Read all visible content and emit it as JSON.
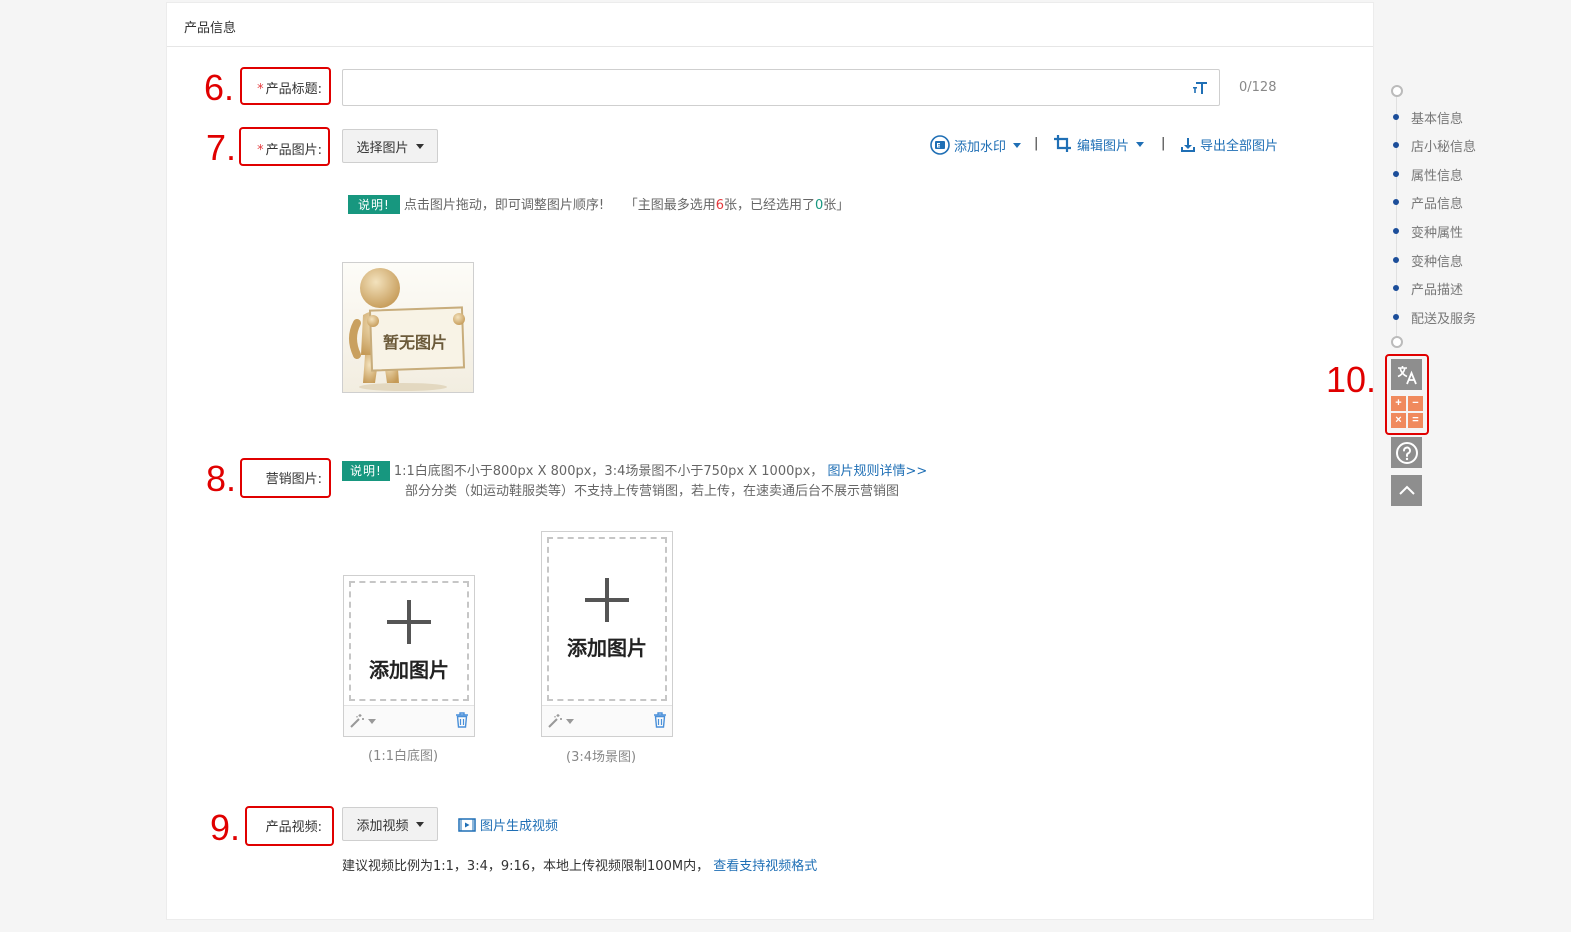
{
  "section": {
    "title": "产品信息"
  },
  "annotations": [
    "6.",
    "7.",
    "8.",
    "9.",
    "10."
  ],
  "product_title": {
    "required_mark": "*",
    "label": "产品标题:",
    "value": "",
    "counter": "0/128"
  },
  "product_images": {
    "required_mark": "*",
    "label": "产品图片:",
    "select_button": "选择图片",
    "tools": {
      "watermark": "添加水印",
      "edit": "编辑图片",
      "export": "导出全部图片",
      "separator": "|"
    },
    "note": {
      "badge": "说明!",
      "text": "点击图片拖动，即可调整图片顺序!",
      "limit_prefix": "「主图最多选用",
      "limit_max": "6",
      "limit_middle": "张，已经选用了",
      "limit_used": "0",
      "limit_suffix": "张」"
    },
    "placeholder_text": "暂无图片"
  },
  "marketing_images": {
    "label": "营销图片:",
    "badge": "说明!",
    "note_line1": "1:1白底图不小于800px X 800px，3:4场景图不小于750px X 1000px，",
    "rules_link": "图片规则详情>>",
    "note_line2": "部分分类（如运动鞋服类等）不支持上传营销图，若上传，在速卖通后台不展示营销图",
    "slots": [
      {
        "add_text": "添加图片",
        "caption": "(1:1白底图)"
      },
      {
        "add_text": "添加图片",
        "caption": "(3:4场景图)"
      }
    ]
  },
  "product_video": {
    "label": "产品视频:",
    "add_button": "添加视频",
    "generate_link": "图片生成视频",
    "note": "建议视频比例为1:1，3:4，9:16，本地上传视频限制100M内，",
    "formats_link": "查看支持视频格式"
  },
  "side_nav": {
    "items": [
      "基本信息",
      "店小秘信息",
      "属性信息",
      "产品信息",
      "变种属性",
      "变种信息",
      "产品描述",
      "配送及服务"
    ]
  },
  "tool_buttons": {
    "calculator_keys": [
      "+",
      "−",
      "×",
      "="
    ]
  },
  "colors": {
    "annotation": "#e00000",
    "link": "#1f6fb5",
    "badge": "#17977f",
    "nav_dot": "#1c4e9a",
    "side_button": "#8e8e8e",
    "calculator": "#f08a5d"
  }
}
